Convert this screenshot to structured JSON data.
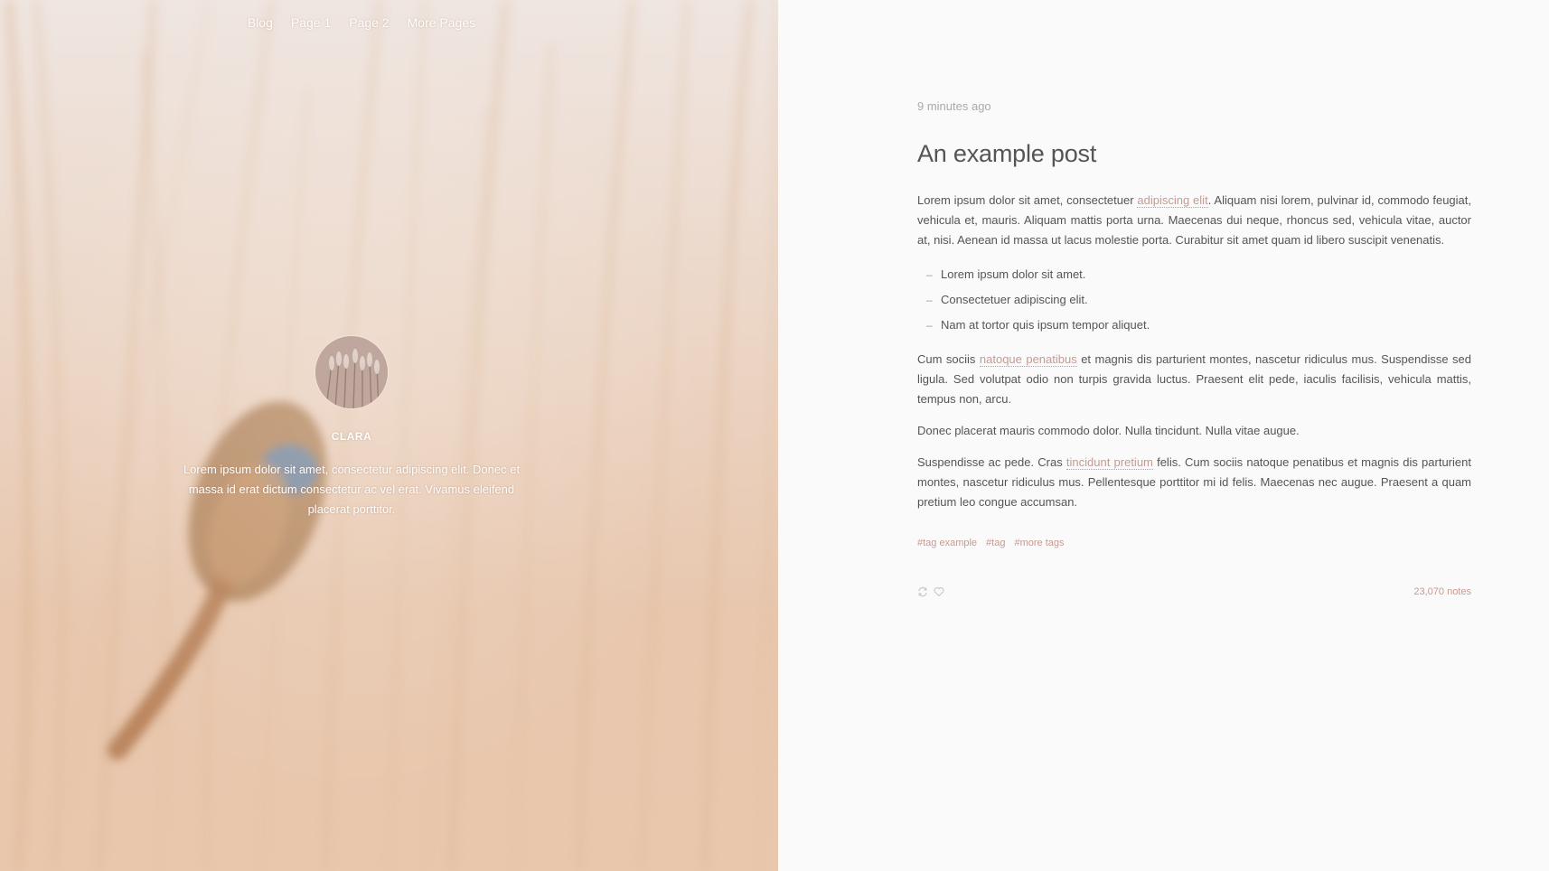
{
  "nav": {
    "items": [
      {
        "label": "Blog"
      },
      {
        "label": "Page 1"
      },
      {
        "label": "Page 2"
      },
      {
        "label": "More Pages"
      }
    ]
  },
  "profile": {
    "name": "CLARA",
    "bio": "Lorem ipsum dolor sit amet, consectetur adipiscing elit. Donec et massa id erat dictum consectetur ac vel erat. Vivamus eleifend placerat porttitor."
  },
  "post": {
    "timestamp": "9 minutes ago",
    "title": "An example post",
    "p1": {
      "before": "Lorem ipsum dolor sit amet, consectetuer ",
      "link": "adipiscing elit",
      "after": ". Aliquam nisi lorem, pulvinar id, commodo feugiat, vehicula et, mauris. Aliquam mattis porta urna. Maecenas dui neque, rhoncus sed, vehicula vitae, auctor at, nisi. Aenean id massa ut lacus molestie porta. Curabitur sit amet quam id libero suscipit venenatis."
    },
    "list": [
      "Lorem ipsum dolor sit amet.",
      "Consectetuer adipiscing elit.",
      "Nam at tortor quis ipsum tempor aliquet."
    ],
    "list_marker": "–",
    "p2": {
      "before": "Cum sociis ",
      "link": "natoque penatibus",
      "after": " et magnis dis parturient montes, nascetur ridiculus mus. Suspendisse sed ligula. Sed volutpat odio non turpis gravida luctus. Praesent elit pede, iaculis facilisis, vehicula mattis, tempus non, arcu."
    },
    "p3": "Donec placerat mauris commodo dolor. Nulla tincidunt. Nulla vitae augue.",
    "p4": {
      "before": "Suspendisse ac pede. Cras ",
      "link": "tincidunt pretium",
      "after": " felis. Cum sociis natoque penatibus et magnis dis parturient montes, nascetur ridiculus mus. Pellentesque porttitor mi id felis. Maecenas nec augue. Praesent a quam pretium leo congue accumsan."
    },
    "tags": [
      "#tag example",
      "#tag",
      "#more tags"
    ],
    "notes": "23,070 notes",
    "icons": [
      "reblog-icon",
      "heart-icon"
    ]
  },
  "colors": {
    "accent": "#c79a90",
    "text": "#555555",
    "muted": "#aaaaaa",
    "right_bg": "#fafafa"
  }
}
